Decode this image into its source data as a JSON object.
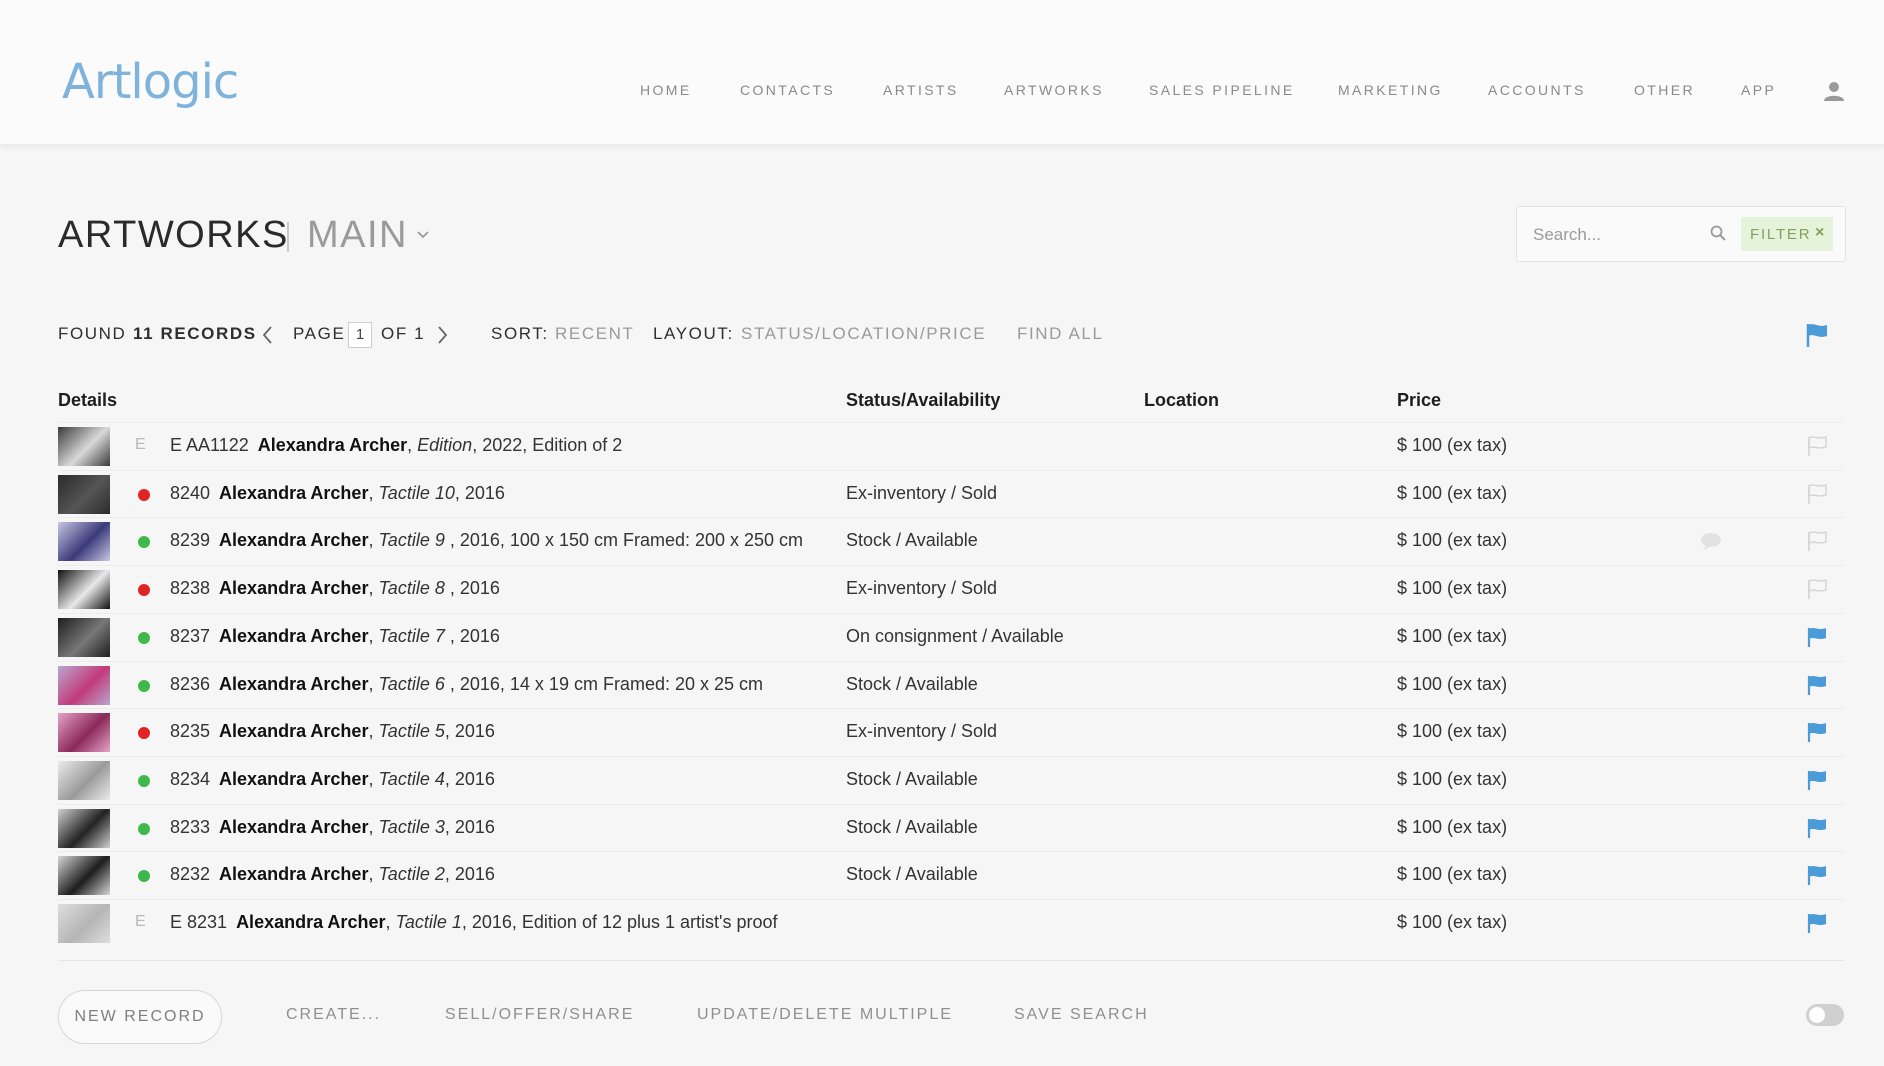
{
  "header": {
    "logo": "Artlogic",
    "nav": [
      "HOME",
      "CONTACTS",
      "ARTISTS",
      "ARTWORKS",
      "SALES PIPELINE",
      "MARKETING",
      "ACCOUNTS",
      "OTHER",
      "APP"
    ]
  },
  "page": {
    "title": "ARTWORKS",
    "subtitle": "MAIN"
  },
  "search": {
    "placeholder": "Search...",
    "filter_label": "FILTER",
    "filter_close": "×"
  },
  "records": {
    "found_label": "FOUND",
    "count": "11 RECORDS",
    "page_label": "PAGE",
    "page_current": "1",
    "page_of": "OF 1",
    "sort_label": "SORT:",
    "sort_value": "RECENT",
    "layout_label": "LAYOUT:",
    "layout_value": "STATUS/LOCATION/PRICE",
    "find_all": "FIND ALL"
  },
  "table": {
    "columns": [
      "Details",
      "Status/Availability",
      "Location",
      "Price"
    ],
    "rows": [
      {
        "mark": "E",
        "dot": "",
        "ref": "E AA1122",
        "artist": "Alexandra Archer",
        "title": "Edition",
        "rest": ", 2022, Edition of 2",
        "status": "",
        "location": "",
        "price": "$ 100 (ex tax)",
        "flag": "outline",
        "comment": false
      },
      {
        "mark": "",
        "dot": "red",
        "ref": "8240",
        "artist": "Alexandra Archer",
        "title": "Tactile 10",
        "rest": ", 2016",
        "status": "Ex-inventory / Sold",
        "location": "",
        "price": "$ 100 (ex tax)",
        "flag": "outline",
        "comment": false
      },
      {
        "mark": "",
        "dot": "green",
        "ref": "8239",
        "artist": "Alexandra Archer",
        "title": "Tactile 9 ",
        "rest": ", 2016, 100 x 150 cm Framed: 200 x 250 cm",
        "status": "Stock / Available",
        "location": "",
        "price": "$ 100 (ex tax)",
        "flag": "outline",
        "comment": true
      },
      {
        "mark": "",
        "dot": "red",
        "ref": "8238",
        "artist": "Alexandra Archer",
        "title": "Tactile 8 ",
        "rest": ", 2016",
        "status": "Ex-inventory / Sold",
        "location": "",
        "price": "$ 100 (ex tax)",
        "flag": "outline",
        "comment": false
      },
      {
        "mark": "",
        "dot": "green",
        "ref": "8237",
        "artist": "Alexandra Archer",
        "title": "Tactile 7 ",
        "rest": ", 2016",
        "status": "On consignment / Available",
        "location": "",
        "price": "$ 100 (ex tax)",
        "flag": "filled",
        "comment": false
      },
      {
        "mark": "",
        "dot": "green",
        "ref": "8236",
        "artist": "Alexandra Archer",
        "title": "Tactile 6 ",
        "rest": ", 2016, 14 x 19 cm Framed: 20 x 25 cm",
        "status": "Stock / Available",
        "location": "",
        "price": "$ 100 (ex tax)",
        "flag": "filled",
        "comment": false
      },
      {
        "mark": "",
        "dot": "red",
        "ref": "8235",
        "artist": "Alexandra Archer",
        "title": "Tactile 5",
        "rest": ", 2016",
        "status": "Ex-inventory / Sold",
        "location": "",
        "price": "$ 100 (ex tax)",
        "flag": "filled",
        "comment": false
      },
      {
        "mark": "",
        "dot": "green",
        "ref": "8234",
        "artist": "Alexandra Archer",
        "title": "Tactile 4",
        "rest": ", 2016",
        "status": "Stock / Available",
        "location": "",
        "price": "$ 100 (ex tax)",
        "flag": "filled",
        "comment": false
      },
      {
        "mark": "",
        "dot": "green",
        "ref": "8233",
        "artist": "Alexandra Archer",
        "title": "Tactile 3",
        "rest": ", 2016",
        "status": "Stock / Available",
        "location": "",
        "price": "$ 100 (ex tax)",
        "flag": "filled",
        "comment": false
      },
      {
        "mark": "",
        "dot": "green",
        "ref": "8232",
        "artist": "Alexandra Archer",
        "title": "Tactile 2",
        "rest": ", 2016",
        "status": "Stock / Available",
        "location": "",
        "price": "$ 100 (ex tax)",
        "flag": "filled",
        "comment": false
      },
      {
        "mark": "E",
        "dot": "",
        "ref": "E 8231",
        "artist": "Alexandra Archer",
        "title": "Tactile 1",
        "rest": ", 2016, Edition of 12 plus 1 artist's proof",
        "status": "",
        "location": "",
        "price": "$ 100 (ex tax)",
        "flag": "filled",
        "comment": false
      }
    ]
  },
  "footer": {
    "new_record": "NEW RECORD",
    "links": [
      "CREATE...",
      "SELL/OFFER/SHARE",
      "UPDATE/DELETE MULTIPLE",
      "SAVE SEARCH"
    ]
  },
  "colors": {
    "brand": "#7fb3dc",
    "flag_blue": "#4a9bd8",
    "dot_green": "#3cb94a",
    "dot_red": "#e02424",
    "filter_bg": "#e4f3d9",
    "filter_text": "#7fa35f"
  },
  "icons": {
    "user": "user-icon",
    "search": "search-icon",
    "chevron": "chevron-down-icon",
    "prev": "chevron-left-icon",
    "next": "chevron-right-icon",
    "flag": "flag-icon",
    "comment": "comment-icon"
  }
}
